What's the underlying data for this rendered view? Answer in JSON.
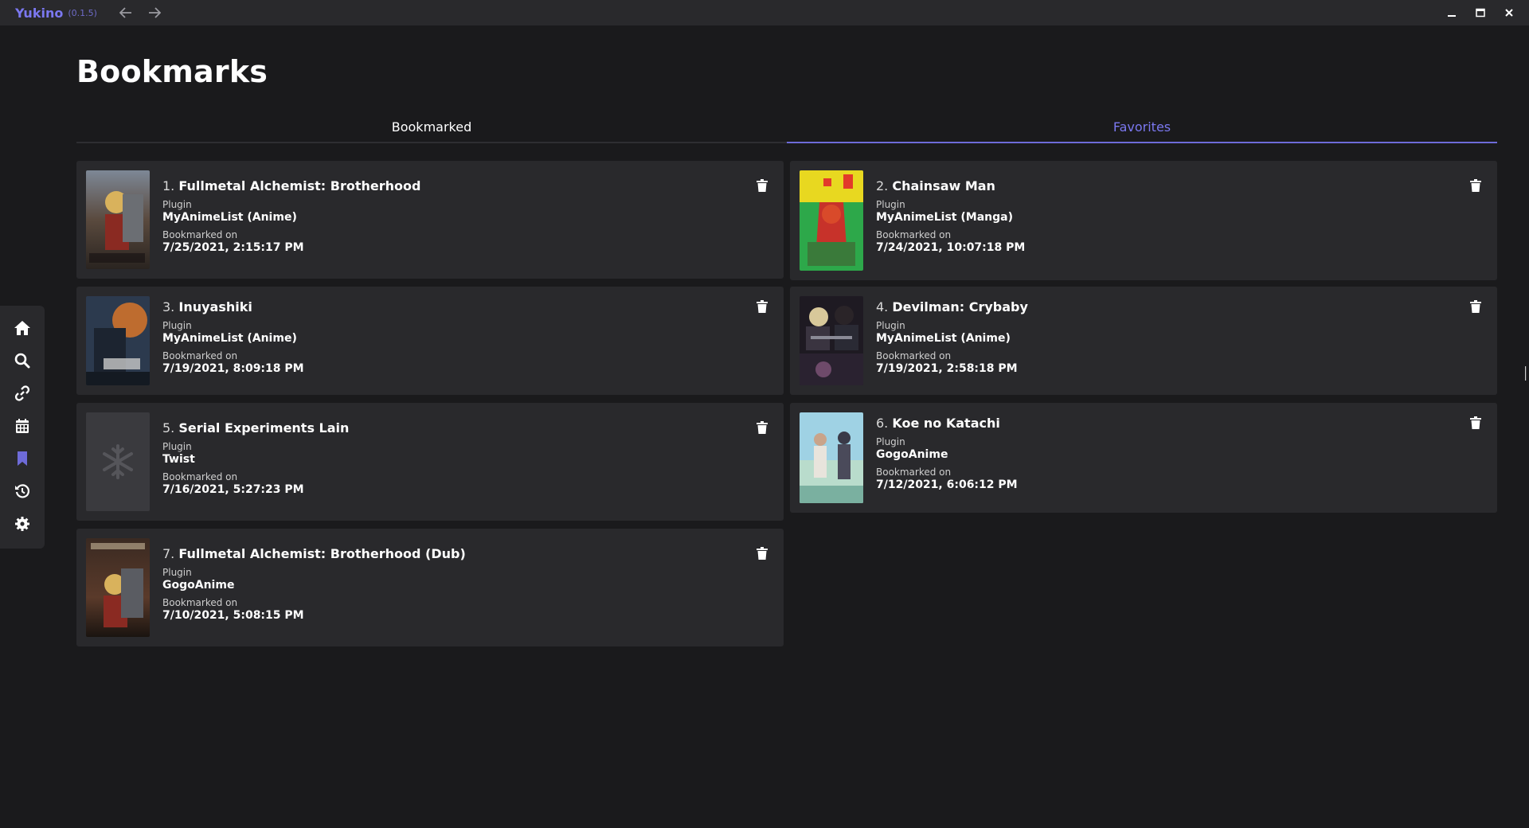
{
  "app": {
    "name": "Yukino",
    "version": "(0.1.5)"
  },
  "colors": {
    "accent": "#7b78f0",
    "background": "#1a1a1c",
    "surface": "#29292c"
  },
  "sidebar": {
    "items": [
      {
        "icon": "home-icon",
        "active": false
      },
      {
        "icon": "search-icon",
        "active": false
      },
      {
        "icon": "link-icon",
        "active": false
      },
      {
        "icon": "calendar-icon",
        "active": false
      },
      {
        "icon": "bookmark-icon",
        "active": true
      },
      {
        "icon": "history-icon",
        "active": false
      },
      {
        "icon": "settings-icon",
        "active": false
      }
    ]
  },
  "page": {
    "title": "Bookmarks"
  },
  "tabs": [
    {
      "label": "Bookmarked",
      "active": false
    },
    {
      "label": "Favorites",
      "active": true
    }
  ],
  "labels": {
    "plugin": "Plugin",
    "bookmarked_on": "Bookmarked on"
  },
  "bookmarks": [
    {
      "index": "1.",
      "title": "Fullmetal Alchemist: Brotherhood",
      "plugin": "MyAnimeList (Anime)",
      "date": "7/25/2021, 2:15:17 PM"
    },
    {
      "index": "2.",
      "title": "Chainsaw Man",
      "plugin": "MyAnimeList (Manga)",
      "date": "7/24/2021, 10:07:18 PM"
    },
    {
      "index": "3.",
      "title": "Inuyashiki",
      "plugin": "MyAnimeList (Anime)",
      "date": "7/19/2021, 8:09:18 PM"
    },
    {
      "index": "4.",
      "title": "Devilman: Crybaby",
      "plugin": "MyAnimeList (Anime)",
      "date": "7/19/2021, 2:58:18 PM"
    },
    {
      "index": "5.",
      "title": "Serial Experiments Lain",
      "plugin": "Twist",
      "date": "7/16/2021, 5:27:23 PM"
    },
    {
      "index": "6.",
      "title": "Koe no Katachi",
      "plugin": "GogoAnime",
      "date": "7/12/2021, 6:06:12 PM"
    },
    {
      "index": "7.",
      "title": "Fullmetal Alchemist: Brotherhood (Dub)",
      "plugin": "GogoAnime",
      "date": "7/10/2021, 5:08:15 PM"
    }
  ]
}
